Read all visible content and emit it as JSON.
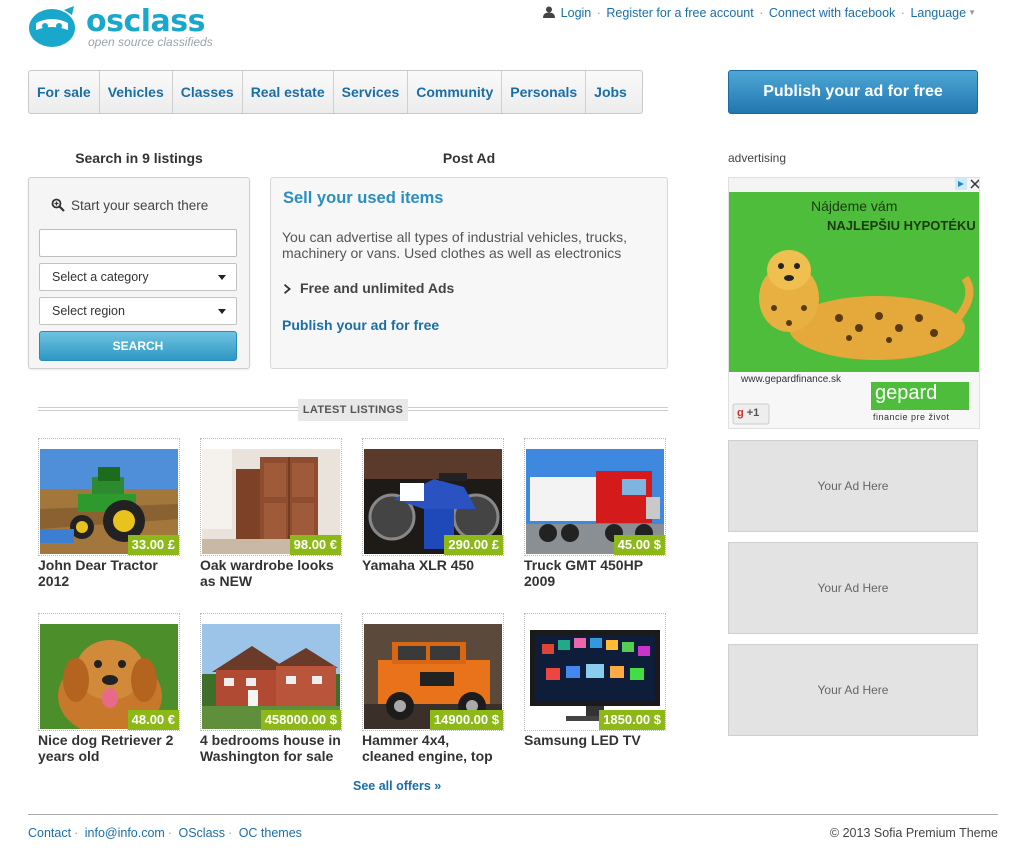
{
  "brand": {
    "name": "osclass",
    "tagline": "open source classifieds",
    "accent": "#19a7cc"
  },
  "toplinks": {
    "login": "Login",
    "register": "Register for a free account",
    "facebook": "Connect with facebook",
    "language": "Language",
    "separator": "·"
  },
  "nav": [
    "For sale",
    "Vehicles",
    "Classes",
    "Real estate",
    "Services",
    "Community",
    "Personals",
    "Jobs"
  ],
  "publish_button": "Publish your ad for free",
  "search": {
    "title": "Search in 9 listings",
    "start_label": "Start your search there",
    "input_value": "",
    "category_select": "Select a category",
    "region_select": "Select region",
    "button": "SEARCH"
  },
  "post_ad": {
    "title": "Post Ad",
    "heading": "Sell your used items",
    "description": "You can advertise all types of industrial vehicles, trucks, machinery or vans. Used clothes as well as electronics",
    "bullet": "Free and unlimited Ads",
    "link": "Publish your ad for free"
  },
  "latest": {
    "label": "LATEST LISTINGS",
    "items": [
      {
        "title": "John Dear Tractor 2012",
        "price": "33.00 £",
        "image": "tractor"
      },
      {
        "title": "Oak wardrobe looks as NEW",
        "price": "98.00 €",
        "image": "wardrobe"
      },
      {
        "title": "Yamaha XLR 450",
        "price": "290.00 £",
        "image": "motorbike"
      },
      {
        "title": "Truck GMT 450HP 2009",
        "price": "45.00 $",
        "image": "truck"
      },
      {
        "title": "Nice dog Retriever 2 years old",
        "price": "48.00 €",
        "image": "dog"
      },
      {
        "title": "4 bedrooms house in Washington for sale",
        "price": "458000.00 $",
        "image": "house"
      },
      {
        "title": "Hammer 4x4, cleaned engine, top",
        "price": "14900.00 $",
        "image": "hummer"
      },
      {
        "title": "Samsung LED TV",
        "price": "1850.00 $",
        "image": "tv"
      }
    ],
    "see_all": "See all offers »"
  },
  "sidebar": {
    "advertising_label": "advertising",
    "banner": {
      "line1": "Nájdeme vám",
      "line2": "NAJLEPŠIU HYPOTÉKU",
      "url": "www.gepardfinance.sk",
      "brand": "gepard",
      "slogan": "financie pre život",
      "gplus": "+1"
    },
    "ad_slots": [
      "Your Ad Here",
      "Your Ad Here",
      "Your Ad Here"
    ]
  },
  "footer": {
    "links": [
      "Contact",
      "info@info.com",
      "OSclass",
      "OC themes"
    ],
    "copyright": "© 2013 Sofia Premium Theme"
  },
  "colors": {
    "link": "#1a6ea8",
    "price_bg": "#8cb818",
    "publish_btn": "#2d86bd",
    "search_btn": "#3ea4cf"
  }
}
